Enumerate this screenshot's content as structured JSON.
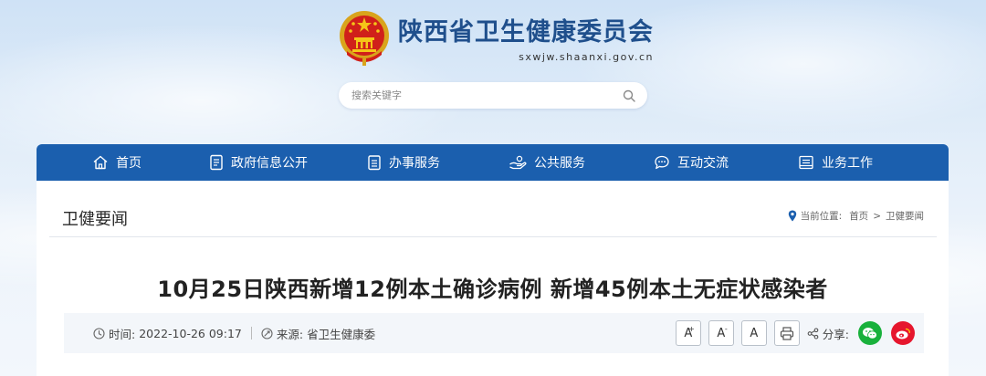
{
  "header": {
    "site_name": "陕西省卫生健康委员会",
    "site_domain": "sxwjw.shaanxi.gov.cn"
  },
  "search": {
    "placeholder": "搜索关键字",
    "icon": "search-icon"
  },
  "nav": {
    "items": [
      {
        "label": "首页",
        "icon": "home-icon"
      },
      {
        "label": "政府信息公开",
        "icon": "document-list-icon"
      },
      {
        "label": "办事服务",
        "icon": "clipboard-icon"
      },
      {
        "label": "公共服务",
        "icon": "hand-service-icon"
      },
      {
        "label": "互动交流",
        "icon": "chat-icon"
      },
      {
        "label": "业务工作",
        "icon": "briefcase-icon"
      }
    ]
  },
  "section": {
    "title": "卫健要闻",
    "breadcrumb_label": "当前位置:",
    "breadcrumb": [
      "首页",
      "卫健要闻"
    ],
    "breadcrumb_sep": ">"
  },
  "article": {
    "title": "10月25日陕西新增12例本土确诊病例 新增45例本土无症状感染者",
    "time_label": "时间:",
    "time_value": "2022-10-26 09:17",
    "source_label": "来源:",
    "source_value": "省卫生健康委"
  },
  "tools": {
    "font_large": "A",
    "font_large_mark": "+",
    "font_small": "A",
    "font_small_mark": "-",
    "font_default": "A",
    "print_icon": "printer-icon",
    "share_label": "分享:",
    "share_targets": [
      "wechat-icon",
      "weibo-icon"
    ]
  },
  "colors": {
    "nav_bg": "#1b5fae",
    "title_blue": "#1f4f8c",
    "wechat_green": "#19b13c",
    "weibo_red": "#e6162d"
  }
}
